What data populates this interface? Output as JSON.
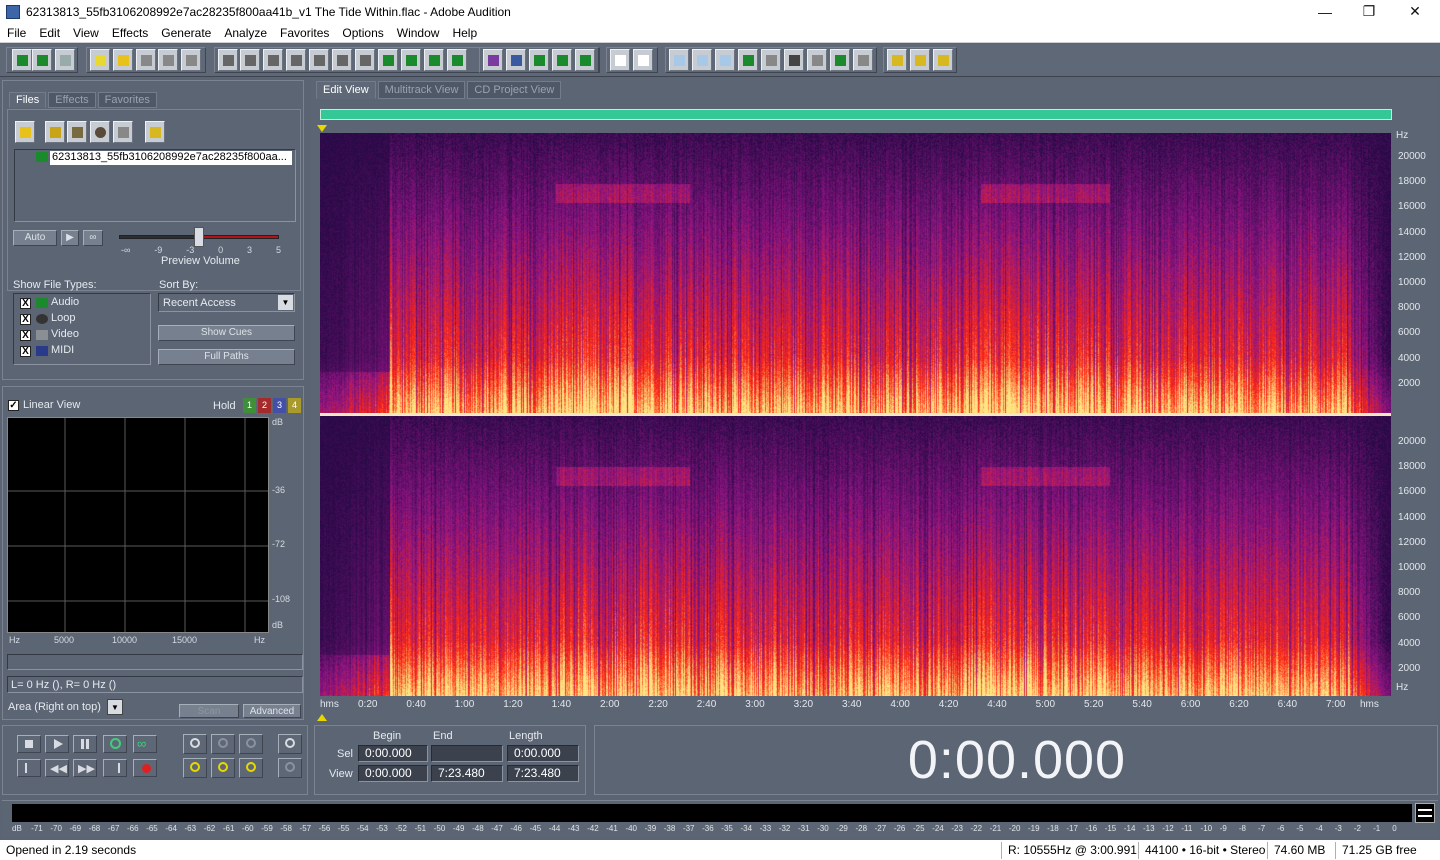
{
  "window": {
    "title": "62313813_55fb3106208992e7ac28235f800aa41b_v1 The Tide Within.flac - Adobe Audition",
    "min": "—",
    "max": "❐",
    "close": "✕"
  },
  "menu": [
    "File",
    "Edit",
    "View",
    "Effects",
    "Generate",
    "Analyze",
    "Favorites",
    "Options",
    "Window",
    "Help"
  ],
  "left_tabs": [
    "Files",
    "Effects",
    "Favorites"
  ],
  "file_item": "62313813_55fb3106208992e7ac28235f800aa...",
  "preview": {
    "auto": "Auto",
    "label": "Preview Volume",
    "ticks": [
      "-∞",
      "-9",
      "-3",
      "0",
      "3",
      "5"
    ]
  },
  "show_types": {
    "label": "Show File Types:",
    "items": [
      "Audio",
      "Loop",
      "Video",
      "MIDI"
    ],
    "check": "X"
  },
  "sort": {
    "label": "Sort By:",
    "value": "Recent Access",
    "show_cues": "Show Cues",
    "full_paths": "Full Paths"
  },
  "analysis": {
    "linear_view": "Linear View",
    "hold": "Hold",
    "hold_buttons": [
      "1",
      "2",
      "3",
      "4"
    ],
    "db_labels": [
      "dB",
      "-36",
      "-72",
      "-108",
      "dB"
    ],
    "x_labels": [
      "Hz",
      "5000",
      "10000",
      "15000",
      "Hz"
    ],
    "readout": "L=       0 Hz (),  R=       0 Hz ()",
    "area_mode": "Area (Right on top)",
    "scan": "Scan",
    "advanced": "Advanced"
  },
  "view_tabs": [
    "Edit View",
    "Multitrack View",
    "CD Project View"
  ],
  "freq_axis": {
    "unit": "Hz",
    "labels": [
      "20000",
      "18000",
      "16000",
      "14000",
      "12000",
      "10000",
      "8000",
      "6000",
      "4000",
      "2000"
    ]
  },
  "time_axis": [
    "hms",
    "0:20",
    "0:40",
    "1:00",
    "1:20",
    "1:40",
    "2:00",
    "2:20",
    "2:40",
    "3:00",
    "3:20",
    "3:40",
    "4:00",
    "4:20",
    "4:40",
    "5:00",
    "5:20",
    "5:40",
    "6:00",
    "6:20",
    "6:40",
    "7:00",
    "hms"
  ],
  "selection": {
    "begin_label": "Begin",
    "end_label": "End",
    "length_label": "Length",
    "sel_label": "Sel",
    "view_label": "View",
    "sel_begin": "0:00.000",
    "sel_end": "",
    "sel_length": "0:00.000",
    "view_begin": "0:00.000",
    "view_end": "7:23.480",
    "view_length": "7:23.480"
  },
  "time_display": "0:00.000",
  "meter_scale": [
    "dB",
    "-71",
    "-70",
    "-69",
    "-68",
    "-67",
    "-66",
    "-65",
    "-64",
    "-63",
    "-62",
    "-61",
    "-60",
    "-59",
    "-58",
    "-57",
    "-56",
    "-55",
    "-54",
    "-53",
    "-52",
    "-51",
    "-50",
    "-49",
    "-48",
    "-47",
    "-46",
    "-45",
    "-44",
    "-43",
    "-42",
    "-41",
    "-40",
    "-39",
    "-38",
    "-37",
    "-36",
    "-35",
    "-34",
    "-33",
    "-32",
    "-31",
    "-30",
    "-29",
    "-28",
    "-27",
    "-26",
    "-25",
    "-24",
    "-23",
    "-22",
    "-21",
    "-20",
    "-19",
    "-18",
    "-17",
    "-16",
    "-15",
    "-14",
    "-13",
    "-12",
    "-11",
    "-10",
    "-9",
    "-8",
    "-7",
    "-6",
    "-5",
    "-4",
    "-3",
    "-2",
    "-1",
    "0"
  ],
  "status": {
    "message": "Opened in 2.19 seconds",
    "cursor": "R: 10555Hz @   3:00.991",
    "format": "44100 • 16-bit • Stereo",
    "size": "74.60 MB",
    "free": "71.25 GB free"
  }
}
